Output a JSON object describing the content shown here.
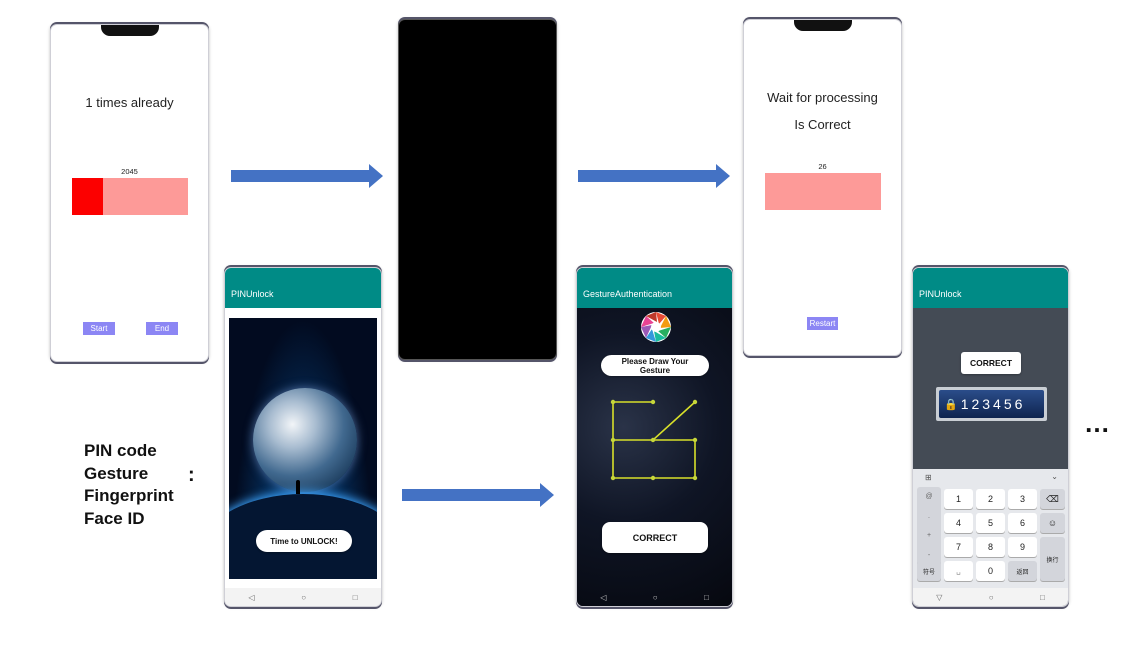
{
  "phone1": {
    "count_text": "1 times already",
    "bar_value": "2045",
    "bar_fill": 0.27,
    "start_label": "Start",
    "end_label": "End"
  },
  "phone3": {
    "line1": "Wait for processing",
    "line2": "Is Correct",
    "bar_value": "26",
    "restart_label": "Restart"
  },
  "pin_phone": {
    "app_title": "PINUnlock",
    "unlock_label": "Time to UNLOCK!"
  },
  "gesture_phone": {
    "app_title": "GestureAuthentication",
    "prompt": "Please Draw Your Gesture",
    "correct_label": "CORRECT"
  },
  "keypad_phone": {
    "app_title": "PINUnlock",
    "correct_label": "CORRECT",
    "pin_display": "123456",
    "keys": {
      "k1": "1",
      "k2": "2",
      "k3": "3",
      "k4": "4",
      "k5": "5",
      "k6": "6",
      "k7": "7",
      "k8": "8",
      "k9": "9",
      "k0": "0",
      "symbols": "符号",
      "back": "返回",
      "newline": "换行"
    }
  },
  "methods": [
    "PIN code",
    "Gesture",
    "Fingerprint",
    "Face ID"
  ],
  "colon": ":",
  "ellipsis": "…",
  "colors": {
    "arrow": "#4472c4",
    "teal": "#008b86",
    "bar_light": "#fd9a98",
    "bar_dark": "#fc0000",
    "button": "#8c86f4"
  }
}
